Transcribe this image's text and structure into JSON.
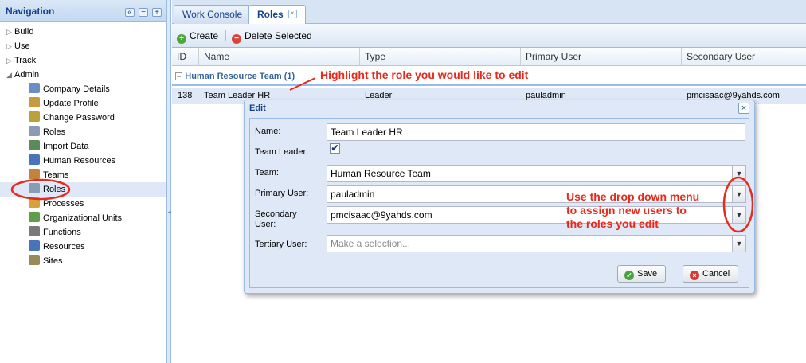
{
  "navigation": {
    "title": "Navigation",
    "tools": [
      "«",
      "−",
      "+"
    ],
    "items": [
      {
        "label": "Build",
        "level": 0,
        "expander": "▷"
      },
      {
        "label": "Use",
        "level": 0,
        "expander": "▷"
      },
      {
        "label": "Track",
        "level": 0,
        "expander": "▷"
      },
      {
        "label": "Admin",
        "level": 0,
        "expander": "◢"
      },
      {
        "label": "Company Details",
        "level": 1,
        "icon": "company-details-icon"
      },
      {
        "label": "Update Profile",
        "level": 1,
        "icon": "update-profile-icon"
      },
      {
        "label": "Change Password",
        "level": 1,
        "icon": "change-password-icon"
      },
      {
        "label": "Roles",
        "level": 1,
        "icon": "roles-key-icon"
      },
      {
        "label": "Import Data",
        "level": 1,
        "icon": "import-data-icon"
      },
      {
        "label": "Human Resources",
        "level": 1,
        "icon": "human-resources-icon"
      },
      {
        "label": "Teams",
        "level": 1,
        "icon": "teams-icon"
      },
      {
        "label": "Roles",
        "level": 1,
        "icon": "roles-person-icon",
        "selected": true
      },
      {
        "label": "Processes",
        "level": 1,
        "icon": "processes-icon"
      },
      {
        "label": "Organizational Units",
        "level": 1,
        "icon": "organizational-units-icon"
      },
      {
        "label": "Functions",
        "level": 1,
        "icon": "functions-gear-icon"
      },
      {
        "label": "Resources",
        "level": 1,
        "icon": "resources-icon"
      },
      {
        "label": "Sites",
        "level": 1,
        "icon": "sites-icon"
      }
    ]
  },
  "tabs": [
    {
      "label": "Work Console",
      "active": false
    },
    {
      "label": "Roles",
      "active": true,
      "close": "×"
    }
  ],
  "toolbar": {
    "create_label": "Create",
    "delete_label": "Delete Selected"
  },
  "grid": {
    "columns": [
      "ID",
      "Name",
      "Type",
      "Primary User",
      "Secondary User"
    ],
    "sort_indicator": "▲",
    "group_label": "Human Resource Team (1)",
    "group_toggle": "−",
    "rows": [
      {
        "id": "138",
        "name": "Team Leader HR",
        "type": "Leader",
        "primary": "pauladmin",
        "secondary": "pmcisaac@9yahds.com"
      }
    ]
  },
  "dialog": {
    "title": "Edit",
    "close": "×",
    "fields": {
      "name_label": "Name:",
      "name_value": "Team Leader HR",
      "team_leader_label": "Team Leader:",
      "team_leader_checked": true,
      "check_mark": "✔",
      "team_label": "Team:",
      "team_value": "Human Resource Team",
      "primary_label": "Primary User:",
      "primary_value": "pauladmin",
      "secondary_label_line1": "Secondary",
      "secondary_label_line2": "User:",
      "secondary_value": "pmcisaac@9yahds.com",
      "tertiary_label": "Tertiary User:",
      "tertiary_placeholder": "Make a selection..."
    },
    "trigger_glyph": "▼",
    "save_label": "Save",
    "cancel_label": "Cancel"
  },
  "annotations": {
    "highlight_text": "Highlight the role you would like to edit",
    "dropdown_line1": "Use the drop down menu",
    "dropdown_line2": "to assign new users to",
    "dropdown_line3": "the roles you edit",
    "color": "#e8291c"
  },
  "colors": {
    "header_text": "#15428b",
    "selection": "#dfe8f6",
    "border": "#99bbe8"
  }
}
